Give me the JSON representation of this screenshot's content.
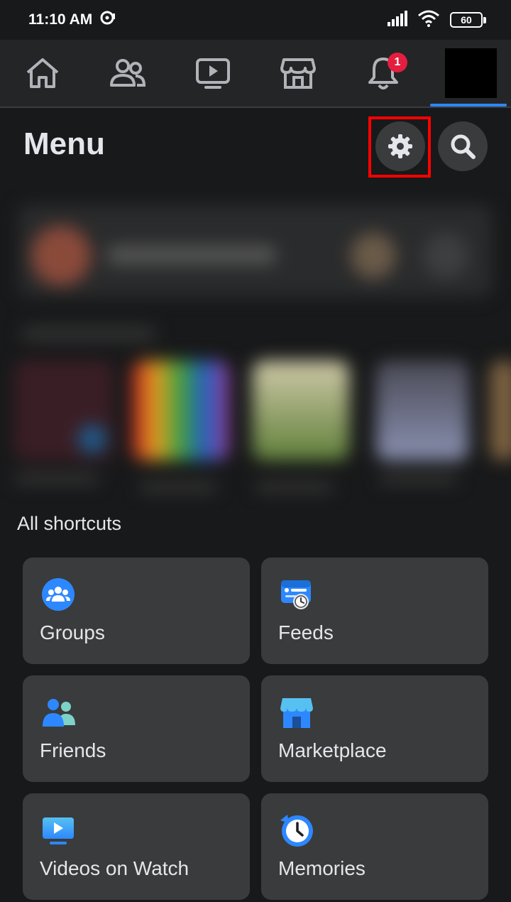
{
  "status_bar": {
    "time": "11:10 AM",
    "battery": "60"
  },
  "nav": {
    "items": [
      "home",
      "friends",
      "watch",
      "marketplace",
      "notifications",
      "profile"
    ],
    "notification_count": "1"
  },
  "header": {
    "title": "Menu"
  },
  "shortcuts": {
    "heading": "All shortcuts",
    "tiles": [
      {
        "label": "Groups",
        "icon": "groups-icon"
      },
      {
        "label": "Feeds",
        "icon": "feeds-icon"
      },
      {
        "label": "Friends",
        "icon": "friends-icon"
      },
      {
        "label": "Marketplace",
        "icon": "marketplace-icon"
      },
      {
        "label": "Videos on Watch",
        "icon": "videos-on-watch-icon"
      },
      {
        "label": "Memories",
        "icon": "memories-icon"
      }
    ]
  },
  "colors": {
    "background": "#18191a",
    "nav_background": "#242526",
    "tile_background": "#3a3b3c",
    "accent_blue": "#2d88ff",
    "badge_red": "#e41e3f",
    "highlight_red": "#ff0000"
  }
}
